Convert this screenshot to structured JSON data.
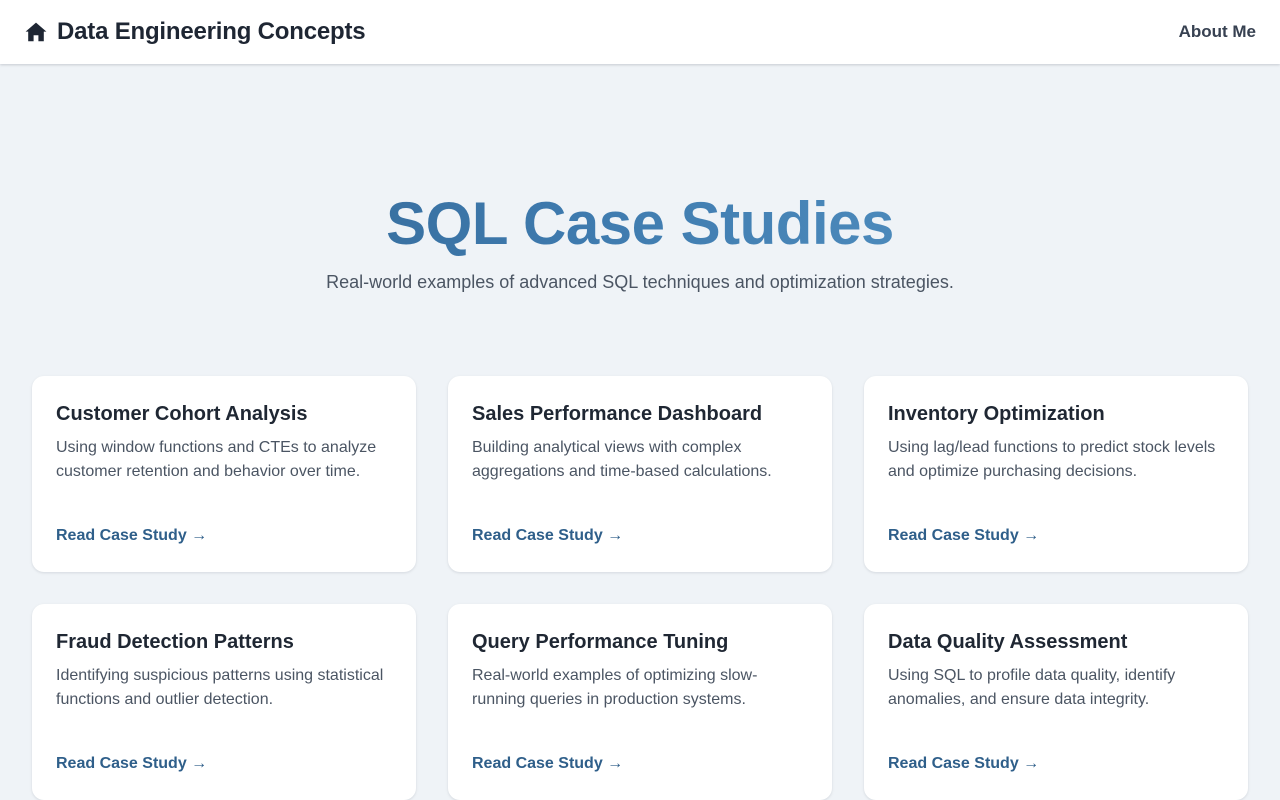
{
  "nav": {
    "brand_icon": "home-icon",
    "brand_title": "Data Engineering Concepts",
    "about_label": "About Me"
  },
  "hero": {
    "title": "SQL Case Studies",
    "subtitle": "Real-world examples of advanced SQL techniques and optimization strategies."
  },
  "colors": {
    "background": "#eff3f7",
    "accent": "#2f5f8a",
    "title_gradient_start": "#2f5f8a",
    "title_gradient_end": "#5b9bca"
  },
  "cards": [
    {
      "title": "Customer Cohort Analysis",
      "description": "Using window functions and CTEs to analyze customer retention and behavior over time.",
      "link": "Read Case Study →"
    },
    {
      "title": "Sales Performance Dashboard",
      "description": "Building analytical views with complex aggregations and time-based calculations.",
      "link": "Read Case Study →"
    },
    {
      "title": "Inventory Optimization",
      "description": "Using lag/lead functions to predict stock levels and optimize purchasing decisions.",
      "link": "Read Case Study →"
    },
    {
      "title": "Fraud Detection Patterns",
      "description": "Identifying suspicious patterns using statistical functions and outlier detection.",
      "link": "Read Case Study →"
    },
    {
      "title": "Query Performance Tuning",
      "description": "Real-world examples of optimizing slow-running queries in production systems.",
      "link": "Read Case Study →"
    },
    {
      "title": "Data Quality Assessment",
      "description": "Using SQL to profile data quality, identify anomalies, and ensure data integrity.",
      "link": "Read Case Study →"
    }
  ]
}
